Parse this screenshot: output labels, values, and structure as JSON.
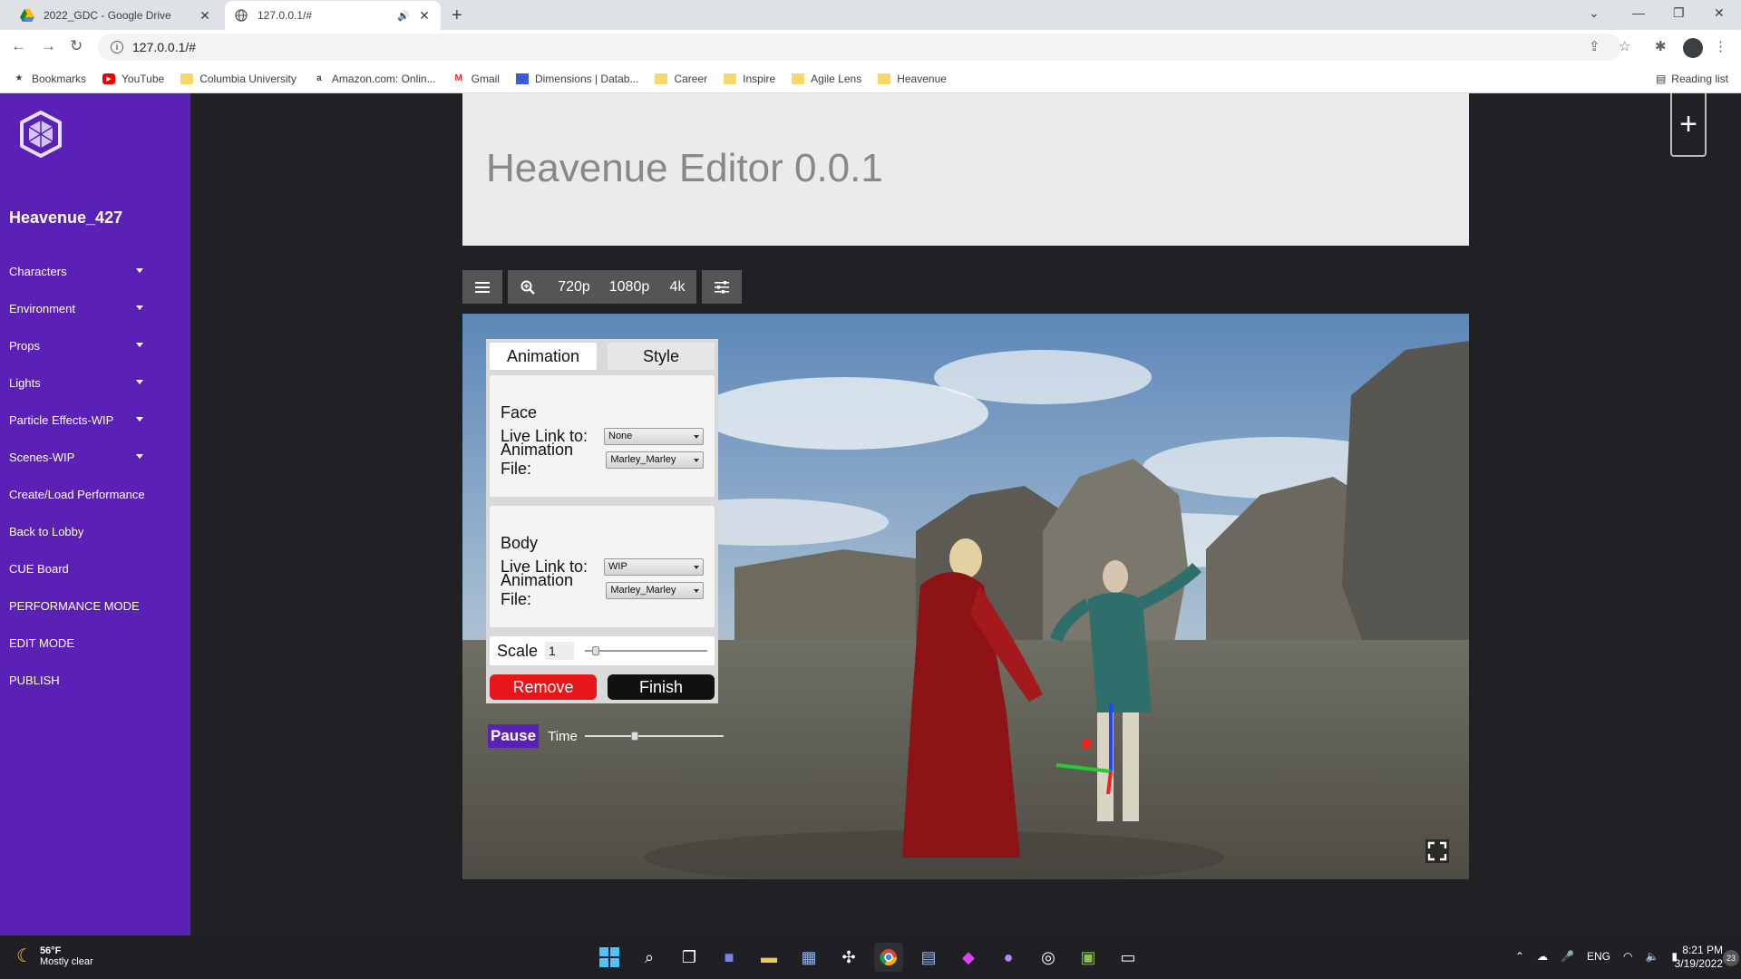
{
  "browser": {
    "tabs": [
      {
        "title": "2022_GDC - Google Drive",
        "active": false
      },
      {
        "title": "127.0.0.1/#",
        "active": true
      }
    ],
    "url": "127.0.0.1/#",
    "bookmarks": [
      {
        "label": "Bookmarks",
        "icon": "star-icon"
      },
      {
        "label": "YouTube",
        "icon": "youtube-icon"
      },
      {
        "label": "Columbia University",
        "icon": "folder-icon"
      },
      {
        "label": "Amazon.com: Onlin...",
        "icon": "amazon-icon"
      },
      {
        "label": "Gmail",
        "icon": "gmail-icon"
      },
      {
        "label": "Dimensions | Datab...",
        "icon": "dimensions-icon"
      },
      {
        "label": "Career",
        "icon": "folder-icon"
      },
      {
        "label": "Inspire",
        "icon": "folder-icon"
      },
      {
        "label": "Agile Lens",
        "icon": "folder-icon"
      },
      {
        "label": "Heavenue",
        "icon": "folder-icon"
      }
    ],
    "reading_list": "Reading list"
  },
  "sidebar": {
    "project_name": "Heavenue_427",
    "items": [
      {
        "label": "Characters",
        "dropdown": true
      },
      {
        "label": "Environment",
        "dropdown": true
      },
      {
        "label": "Props",
        "dropdown": true
      },
      {
        "label": "Lights",
        "dropdown": true
      },
      {
        "label": "Particle Effects-WIP",
        "dropdown": true
      },
      {
        "label": "Scenes-WIP",
        "dropdown": true
      },
      {
        "label": "Create/Load Performance",
        "dropdown": false
      },
      {
        "label": "Back to Lobby",
        "dropdown": false
      },
      {
        "label": "CUE Board",
        "dropdown": false
      },
      {
        "label": "PERFORMANCE MODE",
        "dropdown": false
      },
      {
        "label": "EDIT MODE",
        "dropdown": false
      },
      {
        "label": "PUBLISH",
        "dropdown": false
      }
    ]
  },
  "header": {
    "title": "Heavenue Editor 0.0.1"
  },
  "viewtools": {
    "res_720": "720p",
    "res_1080": "1080p",
    "res_4k": "4k"
  },
  "panel": {
    "tab_animation": "Animation",
    "tab_style": "Style",
    "face": {
      "title": "Face",
      "live_link_label": "Live Link to:",
      "live_link_value": "None",
      "anim_file_label": "Animation File:",
      "anim_file_value": "Marley_Marley"
    },
    "body": {
      "title": "Body",
      "live_link_label": "Live Link to:",
      "live_link_value": "WIP",
      "anim_file_label": "Animation File:",
      "anim_file_value": "Marley_Marley"
    },
    "scale_label": "Scale",
    "scale_value": "1",
    "scale_slider_fraction": 0.06,
    "remove_label": "Remove",
    "finish_label": "Finish",
    "pause_label": "Pause",
    "time_label": "Time",
    "time_slider_fraction": 0.35
  },
  "taskbar": {
    "temperature": "56°F",
    "weather": "Mostly clear",
    "language": "ENG",
    "time": "8:21 PM",
    "date": "3/19/2022",
    "notifications": "23"
  },
  "colors": {
    "accent": "#5b21b6",
    "remove": "#e8161b",
    "finish": "#111111"
  }
}
